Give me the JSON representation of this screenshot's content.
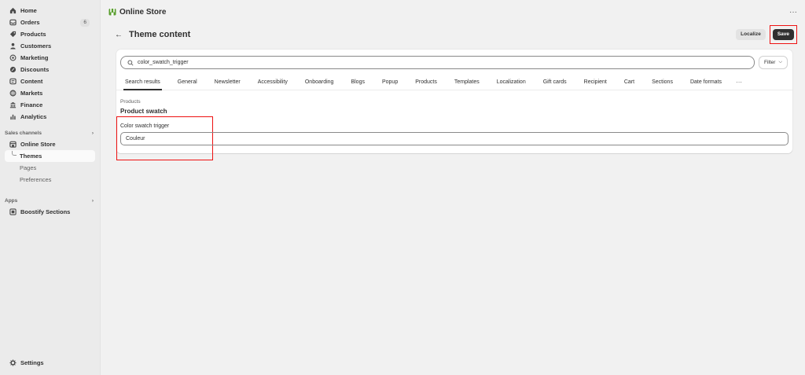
{
  "sidebar": {
    "items": [
      {
        "label": "Home",
        "icon": "home-icon"
      },
      {
        "label": "Orders",
        "icon": "orders-icon",
        "badge": "6"
      },
      {
        "label": "Products",
        "icon": "tag-icon"
      },
      {
        "label": "Customers",
        "icon": "person-icon"
      },
      {
        "label": "Marketing",
        "icon": "target-icon"
      },
      {
        "label": "Discounts",
        "icon": "discount-icon"
      },
      {
        "label": "Content",
        "icon": "content-icon"
      },
      {
        "label": "Markets",
        "icon": "globe-icon"
      },
      {
        "label": "Finance",
        "icon": "bank-icon"
      },
      {
        "label": "Analytics",
        "icon": "bar-chart-icon"
      }
    ],
    "sales_channels": {
      "label": "Sales channels",
      "online_store": "Online Store",
      "themes": "Themes",
      "pages": "Pages",
      "preferences": "Preferences"
    },
    "apps": {
      "label": "Apps",
      "boostify": "Boostify Sections"
    },
    "settings": "Settings"
  },
  "topbar": {
    "store_name": "Online Store",
    "more": "···"
  },
  "header": {
    "back": "←",
    "title": "Theme content",
    "localize": "Localize",
    "save": "Save"
  },
  "search": {
    "value": "color_swatch_trigger",
    "filter": "Filter",
    "filter_chevron": "⌵"
  },
  "tabs": [
    "Search results",
    "General",
    "Newsletter",
    "Accessibility",
    "Onboarding",
    "Blogs",
    "Popup",
    "Products",
    "Templates",
    "Localization",
    "Gift cards",
    "Recipient",
    "Cart",
    "Sections",
    "Date formats"
  ],
  "tabs_more": "···",
  "content": {
    "group": "Products",
    "section": "Product swatch",
    "field_label": "Color swatch trigger",
    "field_value": "Couleur"
  },
  "colors": {
    "highlight": "#ee1111",
    "save_bg": "#303030",
    "store_logo": "#5a9e2f"
  }
}
